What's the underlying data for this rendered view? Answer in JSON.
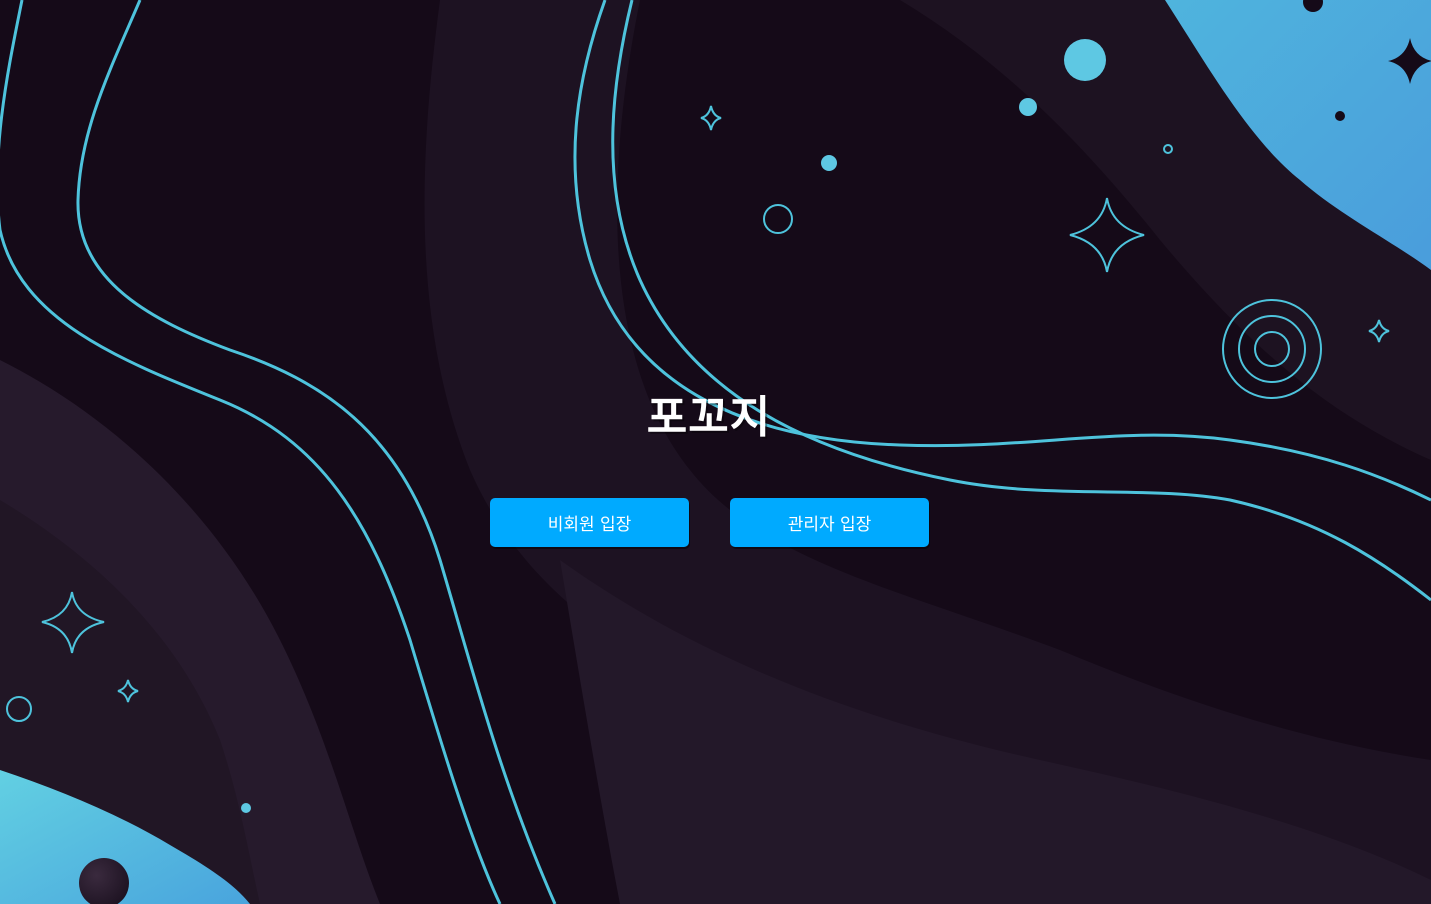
{
  "page": {
    "title": "포꼬지"
  },
  "actions": {
    "guest_label": "비회원 입장",
    "admin_label": "관리자 입장"
  },
  "colors": {
    "background": "#150a18",
    "accent": "#00aaff",
    "line": "#4ec3dc",
    "blob": "#4da3df"
  },
  "decorations": {
    "icons": [
      "sparkle-icon",
      "planet-icon",
      "ring-icon",
      "dot-icon",
      "target-rings-icon"
    ]
  }
}
